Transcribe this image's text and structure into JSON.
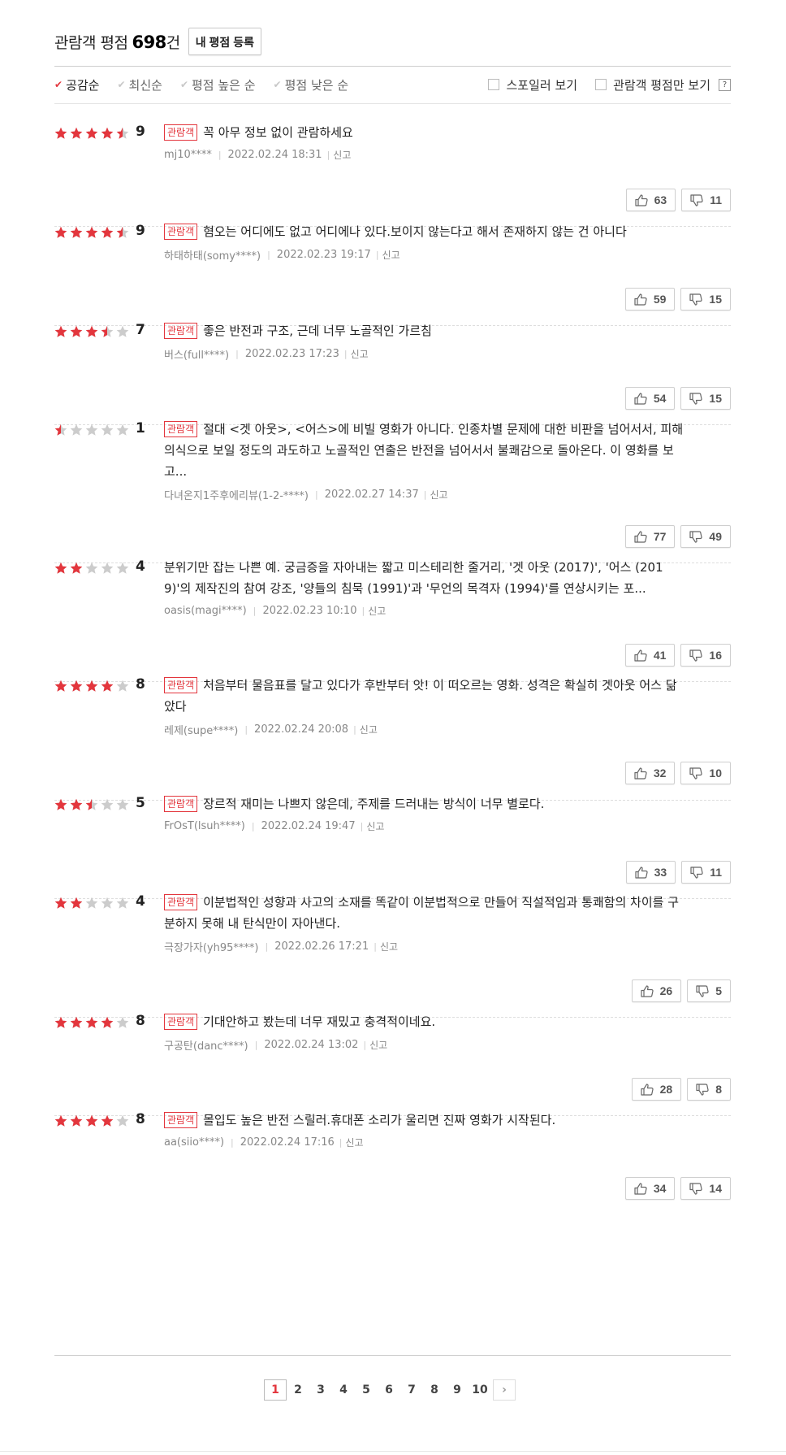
{
  "header": {
    "title": "관람객 평점",
    "count": "698",
    "unit": "건",
    "register_button": "내 평점 등록"
  },
  "sort": {
    "items": [
      "공감순",
      "최신순",
      "평점 높은 순",
      "평점 낮은 순"
    ],
    "active_index": 0
  },
  "filters": {
    "spoiler": "스포일러 보기",
    "audience_only": "관람객 평점만 보기",
    "help": "?"
  },
  "badge_label": "관람객",
  "report_label": "신고",
  "colors": {
    "accent": "#e3363d",
    "star_off": "#cccccc"
  },
  "reviews": [
    {
      "score": "9",
      "badge": true,
      "text": "꼭 아무 정보 없이 관람하세요",
      "author": "mj10****",
      "date": "2022.02.24 18:31",
      "up": "63",
      "down": "11"
    },
    {
      "score": "9",
      "badge": true,
      "text": "혐오는 어디에도 없고 어디에나 있다.보이지 않는다고 해서 존재하지 않는 건 아니다",
      "author": "하태하태(somy****)",
      "date": "2022.02.23 19:17",
      "up": "59",
      "down": "15"
    },
    {
      "score": "7",
      "badge": true,
      "text": "좋은 반전과 구조, 근데 너무 노골적인 가르침",
      "author": "버스(full****)",
      "date": "2022.02.23 17:23",
      "up": "54",
      "down": "15"
    },
    {
      "score": "1",
      "badge": true,
      "text": "절대 <겟 아웃>, <어스>에 비빌 영화가 아니다. 인종차별 문제에 대한 비판을 넘어서서, 피해의식으로 보일 정도의 과도하고 노골적인 연출은 반전을 넘어서서 불쾌감으로 돌아온다. 이 영화를 보고...",
      "author": "다녀온지1주후에리뷰(1-2-****)",
      "date": "2022.02.27 14:37",
      "up": "77",
      "down": "49"
    },
    {
      "score": "4",
      "badge": false,
      "text": "분위기만 잡는 나쁜 예. 궁금증을 자아내는 짧고 미스테리한 줄거리, '겟 아웃 (2017)', '어스 (2019)'의 제작진의 참여 강조, '양들의 침묵 (1991)'과 '무언의 목격자 (1994)'를 연상시키는 포...",
      "author": "oasis(magi****)",
      "date": "2022.02.23 10:10",
      "up": "41",
      "down": "16"
    },
    {
      "score": "8",
      "badge": true,
      "text": "처음부터 물음표를 달고 있다가 후반부터 앗! 이 떠오르는 영화. 성격은 확실히 겟아웃 어스 닮았다",
      "author": "레제(supe****)",
      "date": "2022.02.24 20:08",
      "up": "32",
      "down": "10"
    },
    {
      "score": "5",
      "badge": true,
      "text": "장르적 재미는 나쁘지 않은데, 주제를 드러내는 방식이 너무 별로다.",
      "author": "FrOsT(lsuh****)",
      "date": "2022.02.24 19:47",
      "up": "33",
      "down": "11"
    },
    {
      "score": "4",
      "badge": true,
      "text": "이분법적인 성향과 사고의 소재를 똑같이 이분법적으로 만들어 직설적임과 통쾌함의 차이를 구분하지 못해 내 탄식만이 자아낸다.",
      "author": "극장가자(yh95****)",
      "date": "2022.02.26 17:21",
      "up": "26",
      "down": "5"
    },
    {
      "score": "8",
      "badge": true,
      "text": "기대안하고 봤는데 너무 재밌고 충격적이네요.",
      "author": "구공탄(danc****)",
      "date": "2022.02.24 13:02",
      "up": "28",
      "down": "8"
    },
    {
      "score": "8",
      "badge": true,
      "text": "몰입도 높은 반전 스릴러.휴대폰 소리가 울리면 진짜 영화가 시작된다.",
      "author": "aa(siio****)",
      "date": "2022.02.24 17:16",
      "up": "34",
      "down": "14"
    }
  ],
  "pagination": {
    "pages": [
      "1",
      "2",
      "3",
      "4",
      "5",
      "6",
      "7",
      "8",
      "9",
      "10"
    ],
    "current": "1",
    "next": "›"
  }
}
